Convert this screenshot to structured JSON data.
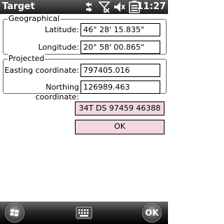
{
  "window": {
    "title": "Target",
    "time": "11:27"
  },
  "status_icons": [
    "sync-icon",
    "no-signal-icon",
    "volume-icon",
    "battery-icon"
  ],
  "geographical": {
    "legend": "Geographical",
    "latitude_label": "Latitude:",
    "latitude_value": "46° 28' 15.835\"",
    "longitude_label": "Longitude:",
    "longitude_value": "20° 58' 00.865\""
  },
  "projected": {
    "legend": "Projected",
    "easting_label": "Easting coordinate:",
    "easting_value": "797405.016",
    "northing_label": "Northing coordinate:",
    "northing_value": "126989.463"
  },
  "grid_reference": "34T DS 97459 46388",
  "ok_label": "OK",
  "softkey_ok_label": "OK",
  "colors": {
    "button_pink": "#f2d8e3",
    "titlebar": "#1c1c1c"
  }
}
